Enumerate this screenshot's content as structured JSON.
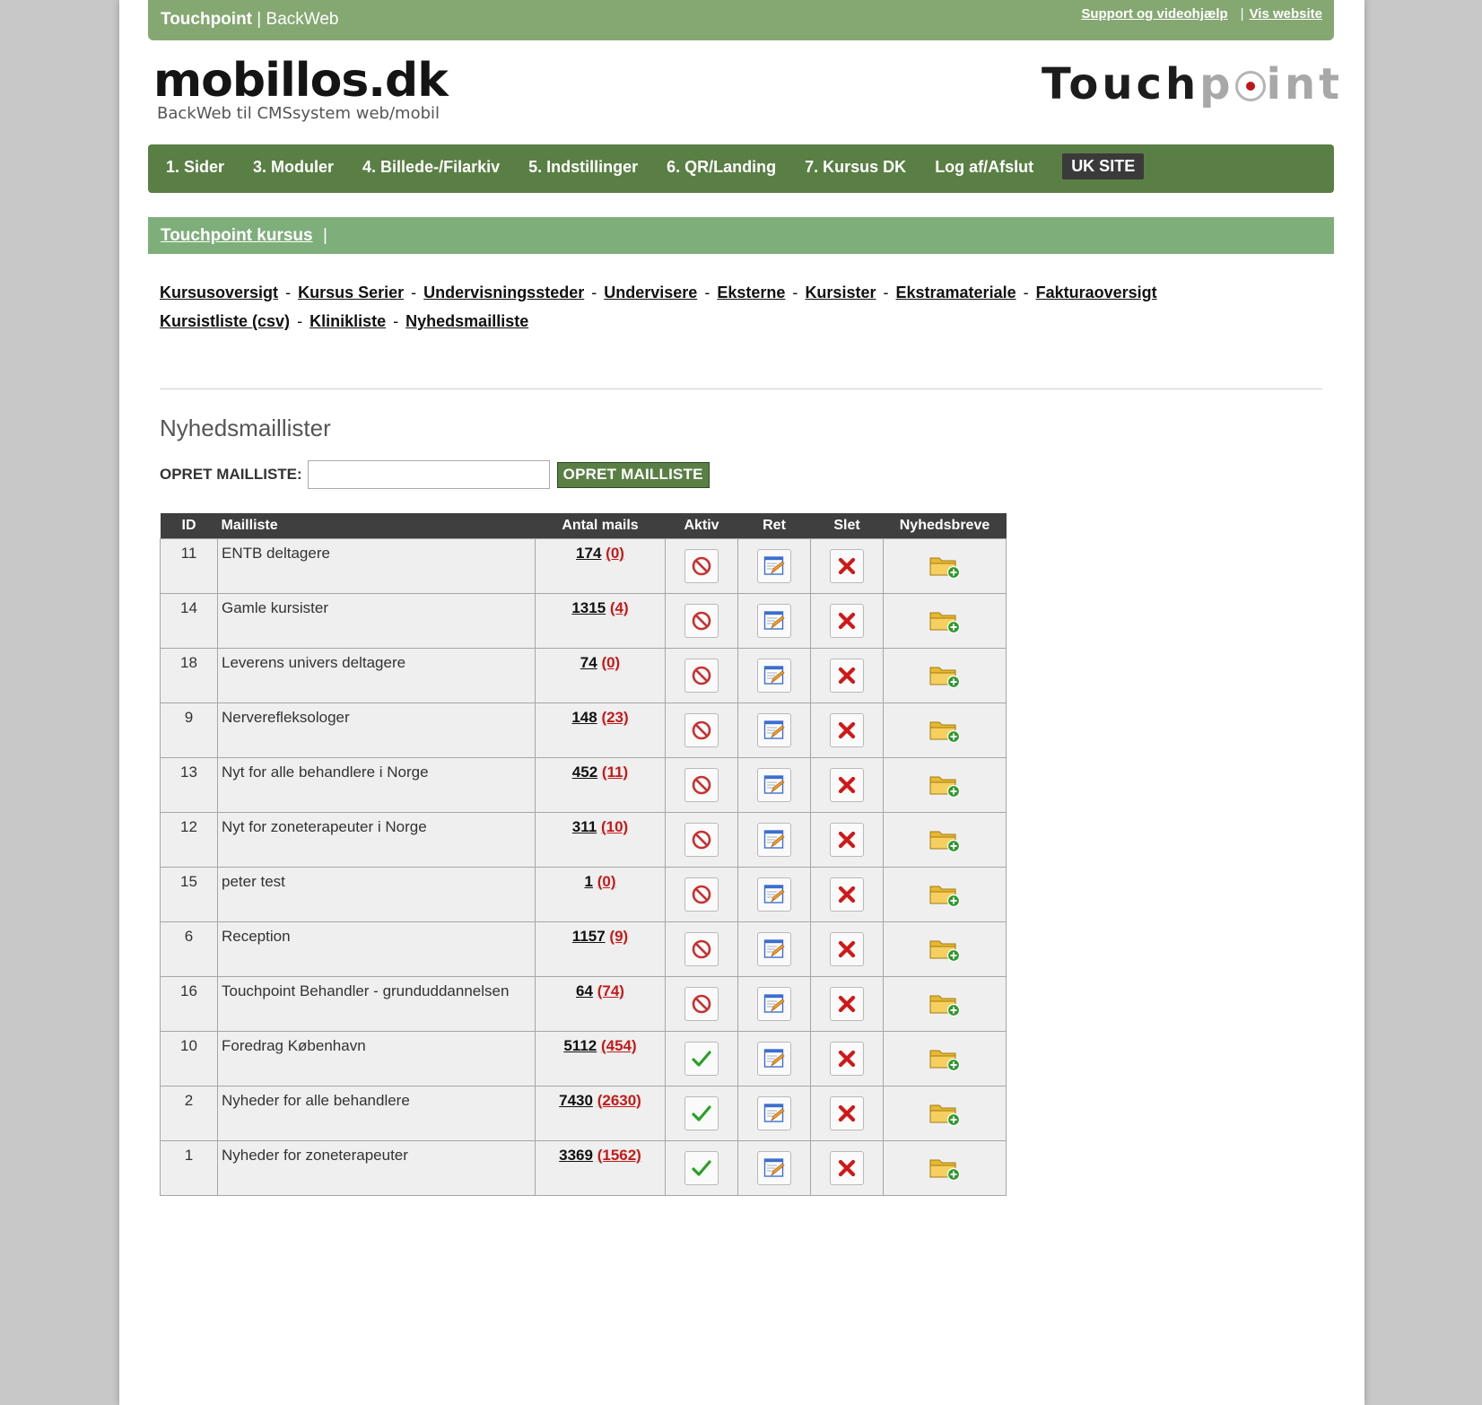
{
  "topbar": {
    "brand_bold": "Touchpoint",
    "brand_sep": " | ",
    "brand_rest": "BackWeb",
    "support_link": "Support og videohjælp",
    "sep": "|",
    "website_link": "Vis website"
  },
  "header": {
    "logo_main": "mobillos.dk",
    "logo_sub": "BackWeb til CMSsystem web/mobil",
    "logo_right_a": "Touch",
    "logo_right_b": "p",
    "logo_right_c": "int"
  },
  "mainnav": {
    "items": [
      {
        "label": "1. Sider"
      },
      {
        "label": "3. Moduler"
      },
      {
        "label": "4. Billede-/Filarkiv"
      },
      {
        "label": "5. Indstillinger"
      },
      {
        "label": "6. QR/Landing"
      },
      {
        "label": "7. Kursus DK"
      },
      {
        "label": "Log af/Afslut"
      }
    ],
    "uk_site": "UK SITE"
  },
  "subbar": {
    "link": "Touchpoint kursus",
    "pipe": "|"
  },
  "sublinks": {
    "items": [
      "Kursusoversigt",
      "Kursus Serier",
      "Undervisningssteder",
      "Undervisere",
      "Eksterne",
      "Kursister",
      "Ekstramateriale",
      "Fakturaoversigt",
      "Kursistliste (csv)",
      "Klinikliste",
      "Nyhedsmailliste"
    ],
    "separator": "-"
  },
  "section": {
    "title": "Nyhedsmaillister",
    "create_label": "OPRET MAILLISTE:",
    "create_input_value": "",
    "create_button": "OPRET MAILLISTE"
  },
  "table": {
    "headers": [
      "ID",
      "Mailliste",
      "Antal mails",
      "Aktiv",
      "Ret",
      "Slet",
      "Nyhedsbreve"
    ],
    "rows": [
      {
        "id": "11",
        "name": "ENTB deltagere",
        "count": "174",
        "unsub": "(0)",
        "active": false
      },
      {
        "id": "14",
        "name": "Gamle kursister",
        "count": "1315",
        "unsub": "(4)",
        "active": false
      },
      {
        "id": "18",
        "name": "Leverens univers deltagere",
        "count": "74",
        "unsub": "(0)",
        "active": false
      },
      {
        "id": "9",
        "name": "Nerverefleksologer",
        "count": "148",
        "unsub": "(23)",
        "active": false
      },
      {
        "id": "13",
        "name": "Nyt for alle behandlere i Norge",
        "count": "452",
        "unsub": "(11)",
        "active": false
      },
      {
        "id": "12",
        "name": "Nyt for zoneterapeuter i Norge",
        "count": "311",
        "unsub": "(10)",
        "active": false
      },
      {
        "id": "15",
        "name": "peter test",
        "count": "1",
        "unsub": "(0)",
        "active": false
      },
      {
        "id": "6",
        "name": "Reception",
        "count": "1157",
        "unsub": "(9)",
        "active": false
      },
      {
        "id": "16",
        "name": "Touchpoint Behandler - grunduddannelsen",
        "count": "64",
        "unsub": "(74)",
        "active": false
      },
      {
        "id": "10",
        "name": "Foredrag København",
        "count": "5112",
        "unsub": "(454)",
        "active": true
      },
      {
        "id": "2",
        "name": "Nyheder for alle behandlere",
        "count": "7430",
        "unsub": "(2630)",
        "active": true
      },
      {
        "id": "1",
        "name": "Nyheder for zoneterapeuter",
        "count": "3369",
        "unsub": "(1562)",
        "active": true
      }
    ]
  },
  "colors": {
    "topbar": "#85a872",
    "nav": "#5a7f45",
    "subbar": "#7eae7a",
    "unsub_red": "#c41a1a",
    "table_header": "#3f3f3f"
  },
  "icons": {
    "inactive": "no-entry-icon",
    "active": "check-icon",
    "edit": "edit-pencil-icon",
    "delete": "delete-x-icon",
    "newsletters": "folder-add-icon"
  }
}
